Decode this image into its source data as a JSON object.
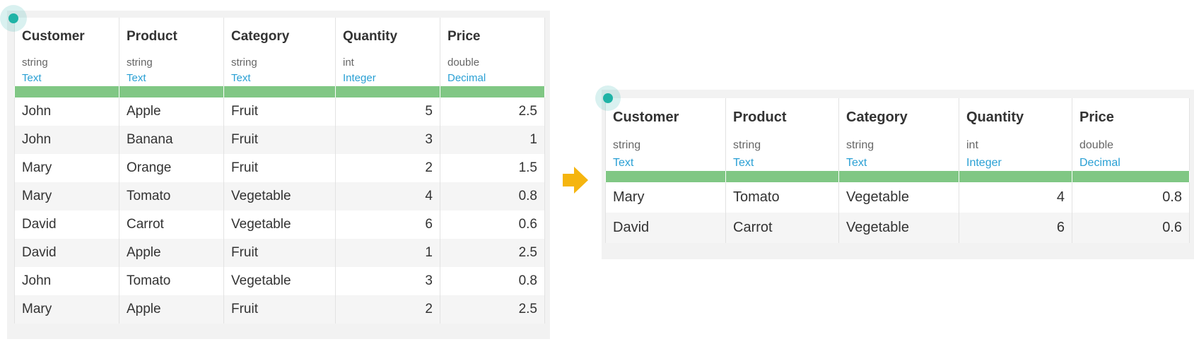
{
  "columns": [
    {
      "name": "Customer",
      "type": "string",
      "kind": "Text"
    },
    {
      "name": "Product",
      "type": "string",
      "kind": "Text"
    },
    {
      "name": "Category",
      "type": "string",
      "kind": "Text"
    },
    {
      "name": "Quantity",
      "type": "int",
      "kind": "Integer"
    },
    {
      "name": "Price",
      "type": "double",
      "kind": "Decimal"
    }
  ],
  "source_table": {
    "rows": [
      [
        "John",
        "Apple",
        "Fruit",
        "5",
        "2.5"
      ],
      [
        "John",
        "Banana",
        "Fruit",
        "3",
        "1"
      ],
      [
        "Mary",
        "Orange",
        "Fruit",
        "2",
        "1.5"
      ],
      [
        "Mary",
        "Tomato",
        "Vegetable",
        "4",
        "0.8"
      ],
      [
        "David",
        "Carrot",
        "Vegetable",
        "6",
        "0.6"
      ],
      [
        "David",
        "Apple",
        "Fruit",
        "1",
        "2.5"
      ],
      [
        "John",
        "Tomato",
        "Vegetable",
        "3",
        "0.8"
      ],
      [
        "Mary",
        "Apple",
        "Fruit",
        "2",
        "2.5"
      ]
    ]
  },
  "result_table": {
    "rows": [
      [
        "Mary",
        "Tomato",
        "Vegetable",
        "4",
        "0.8"
      ],
      [
        "David",
        "Carrot",
        "Vegetable",
        "6",
        "0.6"
      ]
    ]
  },
  "colors": {
    "accent_teal": "#1fb3a6",
    "header_bar": "#80c784",
    "type_label": "#2aa0d4",
    "arrow": "#f5b50f"
  },
  "icons": {
    "transform_arrow": "arrow-right-icon",
    "panel_marker": "selection-dot-icon"
  }
}
